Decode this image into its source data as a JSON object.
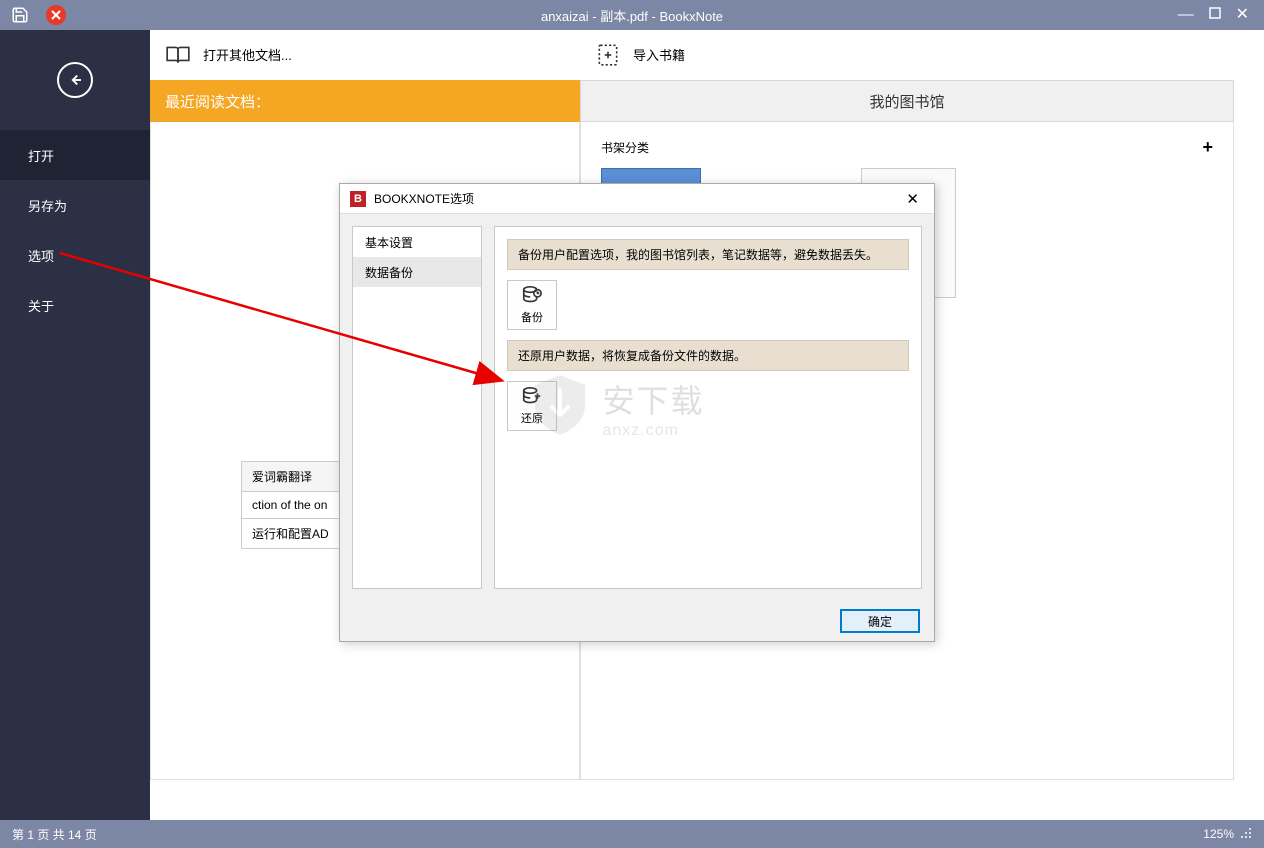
{
  "titlebar": {
    "title": "anxaizai - 副本.pdf - BookxNote"
  },
  "sidebar": {
    "items": [
      "打开",
      "另存为",
      "选项",
      "关于"
    ]
  },
  "leftPanel": {
    "openOther": "打开其他文档...",
    "recentHeader": "最近阅读文档：",
    "snippets": [
      "爱词霸翻译",
      "ction of the on",
      "运行和配置AD"
    ]
  },
  "rightPanel": {
    "importBooks": "导入书籍",
    "libraryHeader": "我的图书馆",
    "shelfLabel": "书架分类"
  },
  "dialog": {
    "title": "BOOKXNOTE选项",
    "nav": [
      "基本设置",
      "数据备份"
    ],
    "backupInfo": "备份用户配置选项，我的图书馆列表，笔记数据等，避免数据丢失。",
    "backupBtn": "备份",
    "restoreInfo": "还原用户数据，将恢复成备份文件的数据。",
    "restoreBtn": "还原",
    "ok": "确定"
  },
  "statusbar": {
    "page": "第 1 页 共 14 页",
    "zoom": "125%"
  },
  "watermark": {
    "cn": "安下载",
    "en": "anxz.com"
  }
}
